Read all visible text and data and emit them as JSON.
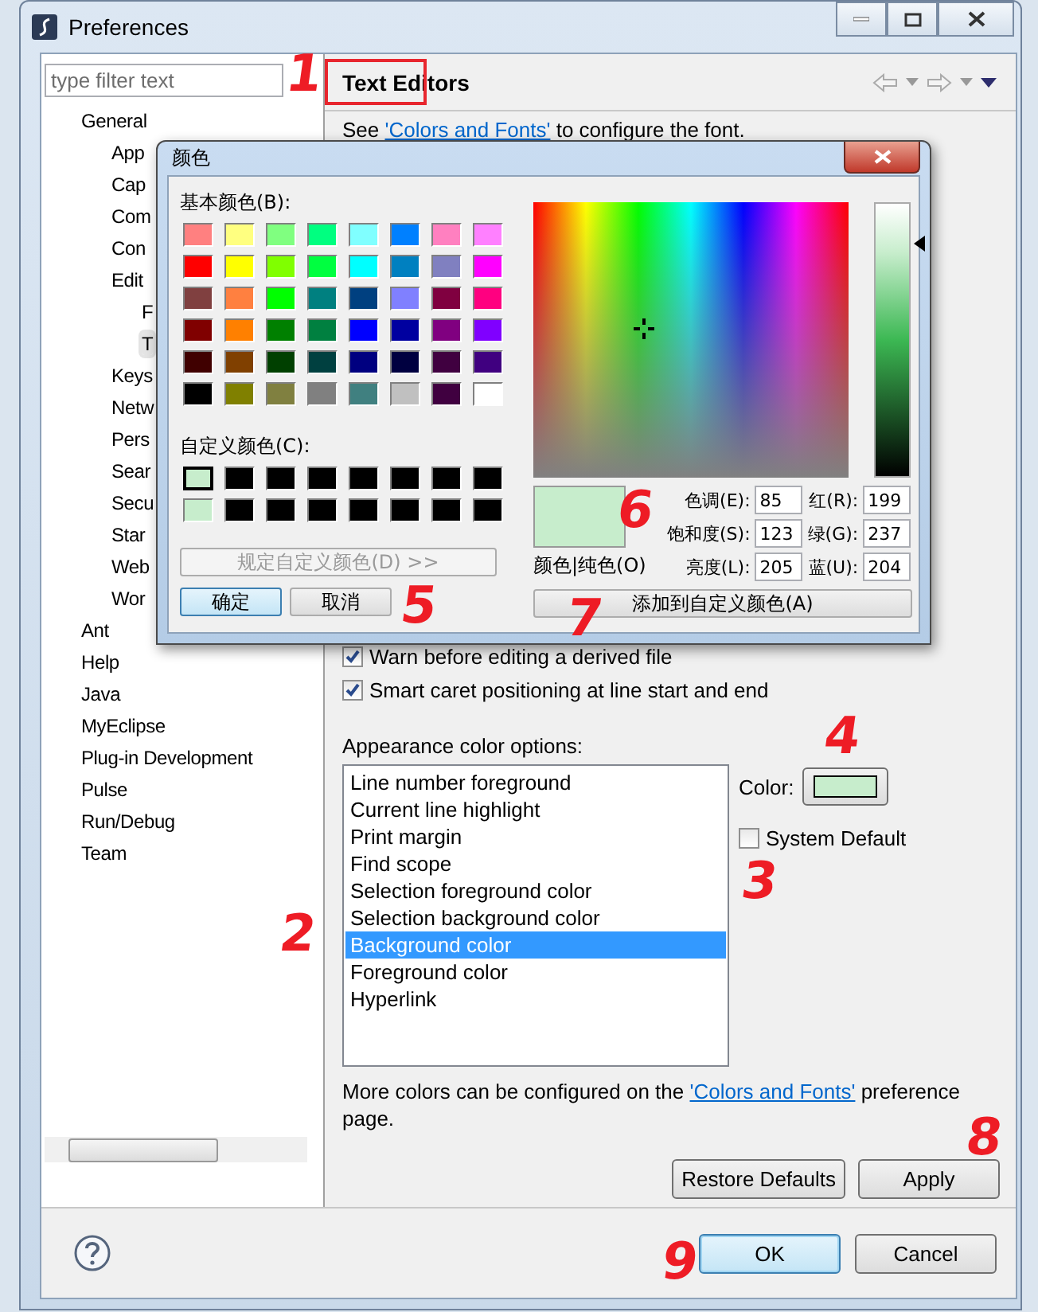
{
  "window": {
    "title": "Preferences"
  },
  "filter": {
    "placeholder": "type filter text"
  },
  "tree": [
    {
      "label": "General",
      "selected": false,
      "children": [
        {
          "label": "App",
          "selected": false
        },
        {
          "label": "Cap",
          "selected": false
        },
        {
          "label": "Com",
          "selected": false
        },
        {
          "label": "Con",
          "selected": false
        },
        {
          "label": "Edit",
          "selected": false,
          "children": [
            {
              "label": "F",
              "selected": false
            },
            {
              "label": "T",
              "selected": true
            }
          ]
        },
        {
          "label": "Keys",
          "selected": false
        },
        {
          "label": "Netw",
          "selected": false
        },
        {
          "label": "Pers",
          "selected": false
        },
        {
          "label": "Sear",
          "selected": false
        },
        {
          "label": "Secu",
          "selected": false
        },
        {
          "label": "Star",
          "selected": false
        },
        {
          "label": "Web",
          "selected": false
        },
        {
          "label": "Wor",
          "selected": false
        }
      ]
    },
    {
      "label": "Ant",
      "selected": false
    },
    {
      "label": "Help",
      "selected": false
    },
    {
      "label": "Java",
      "selected": false
    },
    {
      "label": "MyEclipse",
      "selected": false
    },
    {
      "label": "Plug-in Development",
      "selected": false
    },
    {
      "label": "Pulse",
      "selected": false
    },
    {
      "label": "Run/Debug",
      "selected": false
    },
    {
      "label": "Team",
      "selected": false
    }
  ],
  "page": {
    "title": "Text Editors",
    "title_highlighted": true,
    "intro": {
      "before": "See ",
      "link": "'Colors and Fonts'",
      "after": " to configure the font."
    },
    "options": [
      {
        "label": "Warn before editing a derived file",
        "checked": true
      },
      {
        "label": "Smart caret positioning at line start and end",
        "checked": true
      }
    ],
    "appearance_label": "Appearance color options:",
    "appearance_items": [
      {
        "label": "Line number foreground",
        "selected": false
      },
      {
        "label": "Current line highlight",
        "selected": false
      },
      {
        "label": "Print margin",
        "selected": false
      },
      {
        "label": "Find scope",
        "selected": false
      },
      {
        "label": "Selection foreground color",
        "selected": false
      },
      {
        "label": "Selection background color",
        "selected": false
      },
      {
        "label": "Background color",
        "selected": true
      },
      {
        "label": "Foreground color",
        "selected": false
      },
      {
        "label": "Hyperlink",
        "selected": false
      }
    ],
    "color_label": "Color:",
    "color_button": {
      "color": "#c7edcc"
    },
    "system_default": {
      "label": "System Default",
      "checked": false
    },
    "note": {
      "before": "More colors can be configured on the ",
      "link": "'Colors and Fonts'",
      "after": " preference page."
    },
    "buttons": [
      "Restore Defaults",
      "Apply"
    ]
  },
  "dialog_buttons": [
    {
      "label": "OK",
      "default": true
    },
    {
      "label": "Cancel",
      "default": false
    }
  ],
  "color_dialog": {
    "title": "颜色",
    "basic_label": "基本颜色(B):",
    "basic_colors": [
      {
        "color": "#ff8080"
      },
      {
        "color": "#ffff80"
      },
      {
        "color": "#80ff80"
      },
      {
        "color": "#00ff80"
      },
      {
        "color": "#80ffff"
      },
      {
        "color": "#0080ff"
      },
      {
        "color": "#ff80c0"
      },
      {
        "color": "#ff80ff"
      },
      {
        "color": "#ff0000"
      },
      {
        "color": "#ffff00"
      },
      {
        "color": "#80ff00"
      },
      {
        "color": "#00ff40"
      },
      {
        "color": "#00ffff"
      },
      {
        "color": "#0080c0"
      },
      {
        "color": "#8080c0"
      },
      {
        "color": "#ff00ff"
      },
      {
        "color": "#804040"
      },
      {
        "color": "#ff8040"
      },
      {
        "color": "#00ff00"
      },
      {
        "color": "#008080"
      },
      {
        "color": "#004080"
      },
      {
        "color": "#8080ff"
      },
      {
        "color": "#800040"
      },
      {
        "color": "#ff0080"
      },
      {
        "color": "#800000"
      },
      {
        "color": "#ff8000"
      },
      {
        "color": "#008000"
      },
      {
        "color": "#008040"
      },
      {
        "color": "#0000ff"
      },
      {
        "color": "#0000a0"
      },
      {
        "color": "#800080"
      },
      {
        "color": "#8000ff"
      },
      {
        "color": "#400000"
      },
      {
        "color": "#804000"
      },
      {
        "color": "#004000"
      },
      {
        "color": "#004040"
      },
      {
        "color": "#000080"
      },
      {
        "color": "#000040"
      },
      {
        "color": "#400040"
      },
      {
        "color": "#400080"
      },
      {
        "color": "#000000"
      },
      {
        "color": "#808000"
      },
      {
        "color": "#808040"
      },
      {
        "color": "#808080"
      },
      {
        "color": "#408080"
      },
      {
        "color": "#c0c0c0"
      },
      {
        "color": "#400040"
      },
      {
        "color": "#ffffff"
      }
    ],
    "custom_label": "自定义颜色(C):",
    "custom_colors": [
      {
        "color": "#c7edcc",
        "selected": true
      },
      {
        "color": "#000000",
        "selected": false
      },
      {
        "color": "#000000",
        "selected": false
      },
      {
        "color": "#000000",
        "selected": false
      },
      {
        "color": "#000000",
        "selected": false
      },
      {
        "color": "#000000",
        "selected": false
      },
      {
        "color": "#000000",
        "selected": false
      },
      {
        "color": "#000000",
        "selected": false
      },
      {
        "color": "#c7edcc",
        "selected": false
      },
      {
        "color": "#000000",
        "selected": false
      },
      {
        "color": "#000000",
        "selected": false
      },
      {
        "color": "#000000",
        "selected": false
      },
      {
        "color": "#000000",
        "selected": false
      },
      {
        "color": "#000000",
        "selected": false
      },
      {
        "color": "#000000",
        "selected": false
      },
      {
        "color": "#000000",
        "selected": false
      }
    ],
    "define_button": {
      "label": "规定自定义颜色(D) >>",
      "disabled": true
    },
    "ok": "确定",
    "cancel": "取消",
    "preview_label": "颜色|纯色(O)",
    "fields": [
      {
        "label": "色调(E):",
        "value": "85"
      },
      {
        "label": "红(R):",
        "value": "199"
      },
      {
        "label": "饱和度(S):",
        "value": "123"
      },
      {
        "label": "绿(G):",
        "value": "237"
      },
      {
        "label": "亮度(L):",
        "value": "205"
      },
      {
        "label": "蓝(U):",
        "value": "204"
      }
    ],
    "add_button": "添加到自定义颜色(A)"
  },
  "annotations": [
    {
      "label": "1"
    },
    {
      "label": "5"
    },
    {
      "label": "6"
    },
    {
      "label": "7"
    },
    {
      "label": "4"
    },
    {
      "label": "3"
    },
    {
      "label": "2"
    },
    {
      "label": "8"
    },
    {
      "label": "9"
    }
  ]
}
